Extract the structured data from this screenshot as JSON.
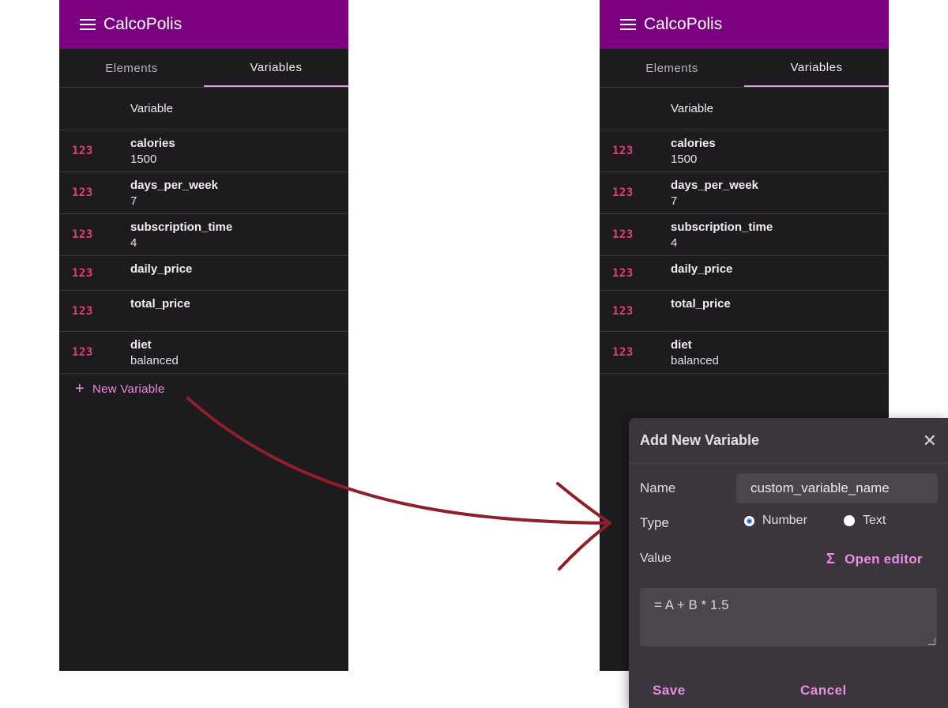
{
  "app_title": "CalcoPolis",
  "tabs": [
    "Elements",
    "Variables"
  ],
  "table_header": "Variable",
  "type_icon_label": "123",
  "variables": [
    {
      "name": "calories",
      "value": "1500"
    },
    {
      "name": "days_per_week",
      "value": "7"
    },
    {
      "name": "subscription_time",
      "value": "4"
    },
    {
      "name": "daily_price",
      "value": ""
    },
    {
      "name": "total_price",
      "value": ""
    },
    {
      "name": "diet",
      "value": "balanced"
    }
  ],
  "new_variable_label": "New Variable",
  "dialog": {
    "title": "Add New Variable",
    "name_label": "Name",
    "name_value": "custom_variable_name",
    "type_label": "Type",
    "type_options": [
      "Number",
      "Text"
    ],
    "type_selected": "Number",
    "value_label": "Value",
    "open_editor_label": "Open editor",
    "formula": "= A + B * 1.5",
    "save_label": "Save",
    "cancel_label": "Cancel"
  },
  "colors": {
    "appbar": "#7b0080",
    "background": "#1e1b1e",
    "accent": "#e88fe4",
    "type_icon": "#e0407a",
    "dialog": "#3d353d",
    "arrow": "#8e1f2c"
  },
  "icons": {
    "menu": "hamburger-icon",
    "type": "number-type-icon",
    "add": "plus-icon",
    "close": "close-icon",
    "editor": "sigma-icon"
  }
}
